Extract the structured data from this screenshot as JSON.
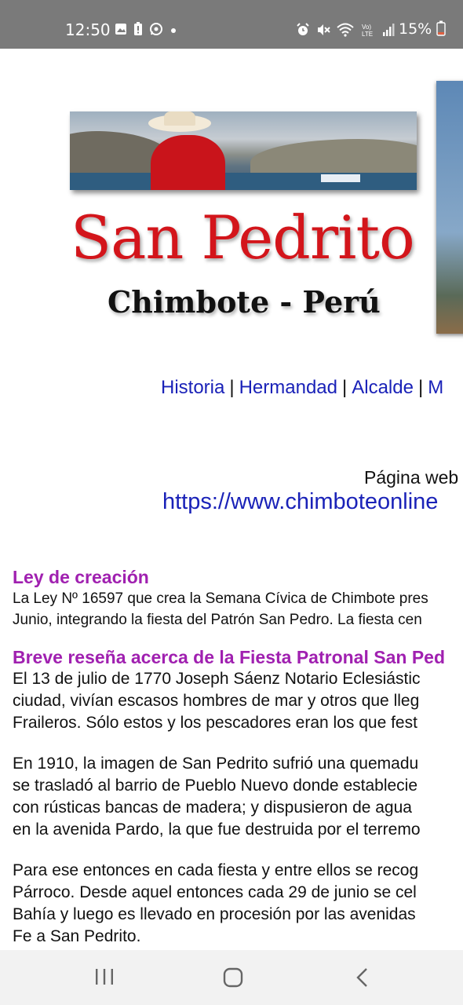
{
  "status_bar": {
    "time": "12:50",
    "battery": "15%"
  },
  "header": {
    "title": "San Pedrito",
    "subtitle": "Chimbote - Perú"
  },
  "nav": {
    "items": [
      "Historia",
      "Hermandad",
      "Alcalde",
      "M"
    ],
    "separator": "|"
  },
  "site": {
    "label": "Página web",
    "url": "https://www.chimboteonline"
  },
  "article": {
    "section1": {
      "heading": "Ley de creación",
      "lines": [
        "La Ley Nº 16597 que crea la Semana Cívica de Chimbote pres",
        "Junio, integrando la fiesta del Patrón San Pedro. La fiesta cen"
      ]
    },
    "section2": {
      "heading": "Breve reseña acerca de la Fiesta Patronal San Ped",
      "p1": [
        "El 13 de julio de 1770 Joseph Sáenz Notario Eclesiástic",
        "ciudad, vivían escasos hombres de mar y otros que lleg",
        "Fraileros. Sólo estos y los pescadores eran los que fest"
      ],
      "p2": [
        "En 1910, la imagen de San Pedrito sufrió una quemadu",
        "se trasladó al barrio de Pueblo Nuevo donde establecie",
        "con rústicas bancas de madera; y dispusieron de agua",
        "en la avenida Pardo, la que fue destruida por el terremo"
      ],
      "p3": [
        "Para ese entonces en cada fiesta y entre ellos se recog",
        "Párroco. Desde aquel entonces cada 29 de junio se cel",
        "Bahía y luego es llevado en procesión por las avenidas",
        "Fe a San Pedrito."
      ]
    }
  },
  "colors": {
    "status_bg": "#7a7a7a",
    "title_red": "#d3151b",
    "link_blue": "#1a22b8",
    "heading_purple": "#a020b0"
  },
  "icons": {
    "status_left": [
      "gallery-icon",
      "battery-alert-icon",
      "whatsapp-icon",
      "dot-icon"
    ],
    "status_right": [
      "alarm-icon",
      "mute-icon",
      "wifi-icon",
      "volte-icon",
      "signal-icon",
      "battery-icon"
    ],
    "bottom_nav": [
      "recent-apps-icon",
      "home-icon",
      "back-icon"
    ]
  }
}
